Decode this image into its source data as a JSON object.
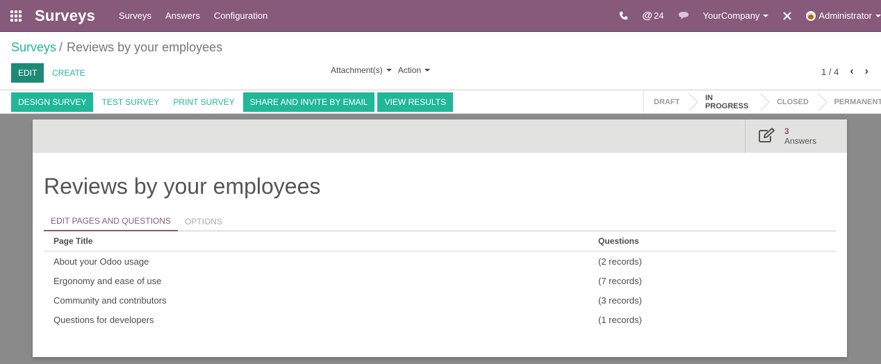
{
  "navbar": {
    "brand": "Surveys",
    "menu": [
      "Surveys",
      "Answers",
      "Configuration"
    ],
    "mentions_count": "24",
    "company": "YourCompany",
    "user": "Administrator"
  },
  "breadcrumb": {
    "parent": "Surveys",
    "separator": "/",
    "current": "Reviews by your employees"
  },
  "actions": {
    "edit": "EDIT",
    "create": "CREATE",
    "attachments": "Attachment(s)",
    "action": "Action"
  },
  "pager": {
    "value": "1 / 4"
  },
  "header_buttons": [
    "DESIGN SURVEY",
    "TEST SURVEY",
    "PRINT SURVEY",
    "SHARE AND INVITE BY EMAIL",
    "VIEW RESULTS"
  ],
  "stages": [
    "DRAFT",
    "IN PROGRESS",
    "CLOSED",
    "PERMANENT"
  ],
  "stat": {
    "value": "3",
    "label": "Answers"
  },
  "record": {
    "title": "Reviews by your employees"
  },
  "tabs": [
    "EDIT PAGES AND QUESTIONS",
    "OPTIONS"
  ],
  "table": {
    "headers": [
      "Page Title",
      "Questions"
    ],
    "rows": [
      [
        "About your Odoo usage",
        "(2 records)"
      ],
      [
        "Ergonomy and ease of use",
        "(7 records)"
      ],
      [
        "Community and contributors",
        "(3 records)"
      ],
      [
        "Questions for developers",
        "(1 records)"
      ]
    ]
  },
  "colors": {
    "primary": "#875a7b",
    "accent": "#21b799"
  },
  "icons": {
    "apps": "apps-grid-icon",
    "phone": "phone-icon",
    "at": "at-icon",
    "chat": "chat-icon",
    "debug": "debug-icon",
    "edit": "pencil-square-icon"
  }
}
